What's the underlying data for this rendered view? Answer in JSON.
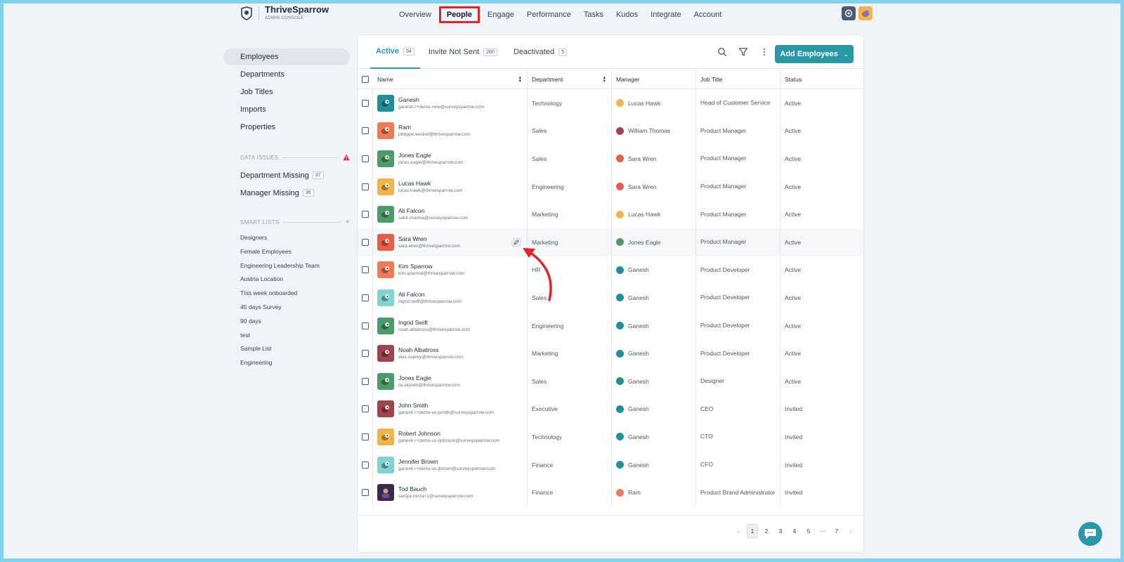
{
  "brand": {
    "name": "ThriveSparrow",
    "subtitle": "ADMIN CONSOLE"
  },
  "topnav": {
    "items": [
      {
        "label": "Overview",
        "active": false
      },
      {
        "label": "People",
        "active": true
      },
      {
        "label": "Engage",
        "active": false
      },
      {
        "label": "Performance",
        "active": false
      },
      {
        "label": "Tasks",
        "active": false
      },
      {
        "label": "Kudos",
        "active": false
      },
      {
        "label": "Integrate",
        "active": false
      },
      {
        "label": "Account",
        "active": false
      }
    ]
  },
  "sidebar": {
    "items": [
      {
        "label": "Employees",
        "active": true
      },
      {
        "label": "Departments"
      },
      {
        "label": "Job Titles"
      },
      {
        "label": "Imports"
      },
      {
        "label": "Properties"
      }
    ],
    "data_issues_title": "DATA ISSUES",
    "data_issues": [
      {
        "label": "Department Missing",
        "count": "37"
      },
      {
        "label": "Manager Missing",
        "count": "36"
      }
    ],
    "smart_lists_title": "SMART LISTS",
    "smart_lists": [
      "Designers",
      "Female Employees",
      "Engineering Leadership Team",
      "Austria Location",
      "This week onboarded",
      "45 days Survey",
      "90 days",
      "test",
      "Sample List",
      "Engineering"
    ]
  },
  "tabs": [
    {
      "label": "Active",
      "count": "94"
    },
    {
      "label": "Invite Not Sent",
      "count": "260"
    },
    {
      "label": "Deactivated",
      "count": "5"
    }
  ],
  "add_button_label": "Add Employees",
  "columns": {
    "name": "Name",
    "department": "Department",
    "manager": "Manager",
    "job_title": "Job Title",
    "status": "Status"
  },
  "rows": [
    {
      "name": "Ganesh",
      "email": "ganesh.r+demo-new@surveysparrow.com",
      "department": "Technology",
      "manager": "Lucas Hawk",
      "job_title": "Head of Customer Service",
      "status": "Active",
      "avatar_color": "#1e8f9b",
      "mgr_color": "#f0b54a"
    },
    {
      "name": "Ram",
      "email": "philippe.kestrel@thrivesparrow.com",
      "department": "Sales",
      "manager": "William Thomas",
      "job_title": "Product Manager",
      "status": "Active",
      "avatar_color": "#ee7a5a",
      "mgr_color": "#a0434f"
    },
    {
      "name": "Jones Eagle",
      "email": "jones.eagle@thrivesparrow.com",
      "department": "Sales",
      "manager": "Sara Wren",
      "job_title": "Product Manager",
      "status": "Active",
      "avatar_color": "#4d9b6a",
      "mgr_color": "#e85d4a"
    },
    {
      "name": "Lucas Hawk",
      "email": "lucas.hawk@thrivesparrow.com",
      "department": "Engineering",
      "manager": "Sara Wren",
      "job_title": "Product Manager",
      "status": "Active",
      "avatar_color": "#f0b54a",
      "mgr_color": "#e85d4a"
    },
    {
      "name": "Ali Falcon",
      "email": "sahil.sharma@surveysparrow.com",
      "department": "Marketing",
      "manager": "Lucas Hawk",
      "job_title": "Product Manager",
      "status": "Active",
      "avatar_color": "#4d9b6a",
      "mgr_color": "#f0b54a"
    },
    {
      "name": "Sara Wren",
      "email": "sara.wren@thrivesparrow.com",
      "department": "Marketing",
      "manager": "Jones Eagle",
      "job_title": "Product Manager",
      "status": "Active",
      "avatar_color": "#e85d4a",
      "mgr_color": "#4d9b6a"
    },
    {
      "name": "Kim Sparrow",
      "email": "kim.sparrow@thrivesparrow.com",
      "department": "HR",
      "manager": "Ganesh",
      "job_title": "Product Developer",
      "status": "Active",
      "avatar_color": "#ee7a5a",
      "mgr_color": "#1e8f9b"
    },
    {
      "name": "Ali Falcon",
      "email": "ingrid.swift@thrivesparrow.com",
      "department": "Sales",
      "manager": "Ganesh",
      "job_title": "Product Developer",
      "status": "Active",
      "avatar_color": "#7fd3d0",
      "mgr_color": "#1e8f9b"
    },
    {
      "name": "Ingrid Swift",
      "email": "noah.albatross@thrivesparrow.com",
      "department": "Engineering",
      "manager": "Ganesh",
      "job_title": "Product Developer",
      "status": "Active",
      "avatar_color": "#4d9b6a",
      "mgr_color": "#1e8f9b"
    },
    {
      "name": "Noah Albatross",
      "email": "alex.osprey@thrivesparrow.com",
      "department": "Marketing",
      "manager": "Ganesh",
      "job_title": "Product Developer",
      "status": "Active",
      "avatar_color": "#a0434f",
      "mgr_color": "#1e8f9b"
    },
    {
      "name": "Jones Eagle",
      "email": "lia.skylark@thrivesparrow.com",
      "department": "Sales",
      "manager": "Ganesh",
      "job_title": "Designer",
      "status": "Active",
      "avatar_color": "#4d9b6a",
      "mgr_color": "#1e8f9b"
    },
    {
      "name": "John Smith",
      "email": "ganesh.r+demo-us-jsmith@surveysparrow.com",
      "department": "Executive",
      "manager": "Ganesh",
      "job_title": "CEO",
      "status": "Invited",
      "avatar_color": "#a0434f",
      "mgr_color": "#1e8f9b"
    },
    {
      "name": "Robert Johnson",
      "email": "ganesh.r+demo-us-rjohnson@surveysparrow.com",
      "department": "Technology",
      "manager": "Ganesh",
      "job_title": "CTO",
      "status": "Invited",
      "avatar_color": "#f0b54a",
      "mgr_color": "#1e8f9b"
    },
    {
      "name": "Jennifer Brown",
      "email": "ganesh.r+demo-us-jbrown@surveysparrow.com",
      "department": "Finance",
      "manager": "Ganesh",
      "job_title": "CFO",
      "status": "Invited",
      "avatar_color": "#7fd3d0",
      "mgr_color": "#1e8f9b"
    },
    {
      "name": "Tod Bauch",
      "email": "saniya.mirza+1@surveysparrow.com",
      "department": "Finance",
      "manager": "Ram",
      "job_title": "Product Brand Administrator",
      "status": "Invited",
      "avatar_color": "#3b2a4a",
      "mgr_color": "#ee7a5a"
    }
  ],
  "pagination": [
    "1",
    "2",
    "3",
    "4",
    "5",
    "···",
    "7"
  ],
  "pagination_current": "1"
}
